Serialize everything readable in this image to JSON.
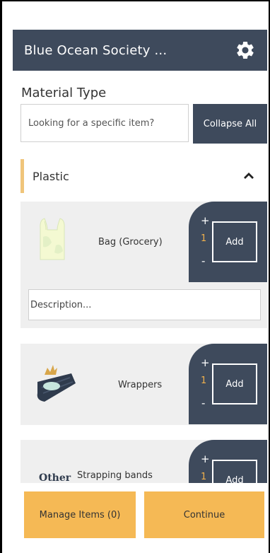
{
  "header": {
    "title": "Blue Ocean Society ...",
    "settings_icon": "gear-icon"
  },
  "material": {
    "label": "Material Type",
    "search_placeholder": "Looking for a specific item?",
    "collapse_label": "Collapse All"
  },
  "category": {
    "label": "Plastic",
    "chevron_icon": "chevron-up-icon",
    "accent_color": "#f0c57b"
  },
  "items": [
    {
      "name": "Bag (Grocery)",
      "plus": "+",
      "quantity": "1",
      "minus": "-",
      "add_label": "Add",
      "description_placeholder": "Description...",
      "icon": "grocery-bag-icon"
    },
    {
      "name": "Wrappers",
      "plus": "+",
      "quantity": "1",
      "minus": "-",
      "add_label": "Add",
      "icon": "wrapper-icon"
    },
    {
      "name": "Strapping bands",
      "plus": "+",
      "quantity": "1",
      "minus": "-",
      "add_label": "Add",
      "icon_text": "Other"
    }
  ],
  "footer": {
    "manage_label": "Manage Items (0)",
    "continue_label": "Continue"
  },
  "colors": {
    "header_bg": "#3e4a5c",
    "button_orange": "#f5b955",
    "quantity": "#f0b04d"
  }
}
